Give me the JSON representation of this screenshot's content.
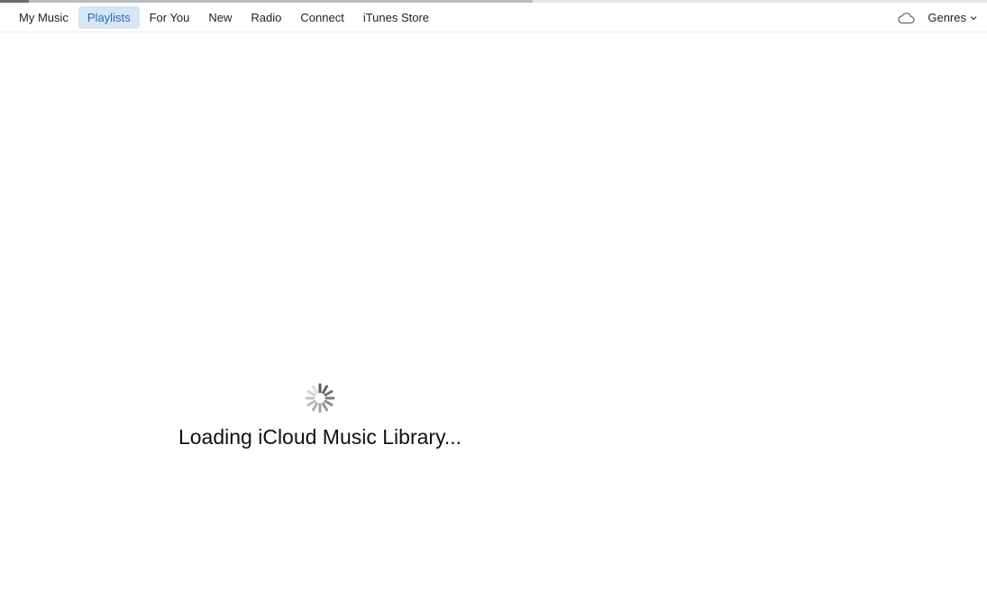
{
  "progress": {
    "fraction": 0.54
  },
  "nav": {
    "tabs": [
      {
        "label": "My Music",
        "active": false
      },
      {
        "label": "Playlists",
        "active": true
      },
      {
        "label": "For You",
        "active": false
      },
      {
        "label": "New",
        "active": false
      },
      {
        "label": "Radio",
        "active": false
      },
      {
        "label": "Connect",
        "active": false
      },
      {
        "label": "iTunes Store",
        "active": false
      }
    ]
  },
  "toolbar": {
    "cloud_icon": "cloud-icon",
    "genres_label": "Genres",
    "genres_icon": "chevron-down-icon"
  },
  "status": {
    "spinner_icon": "spinner-icon",
    "message": "Loading iCloud Music Library..."
  },
  "colors": {
    "active_tab_bg": "#d6e6f7",
    "active_tab_text": "#2a67b0"
  }
}
